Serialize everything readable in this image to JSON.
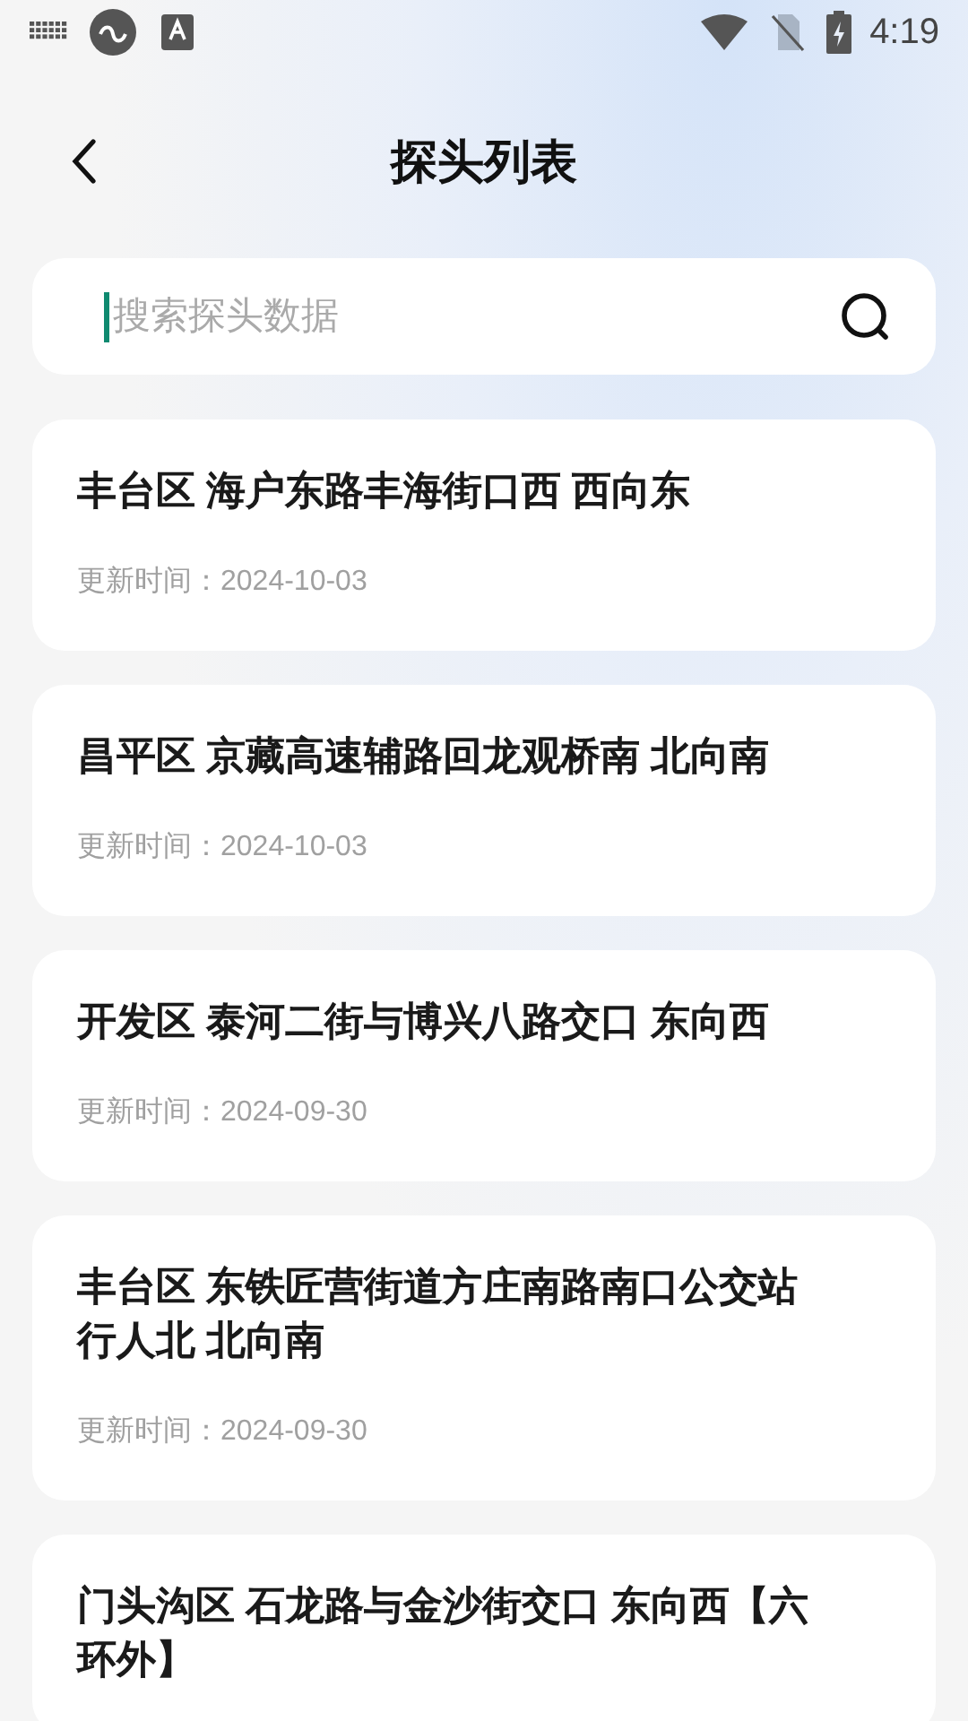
{
  "status_bar": {
    "time": "4:19"
  },
  "header": {
    "title": "探头列表"
  },
  "search": {
    "placeholder": "搜索探头数据",
    "focused": true
  },
  "probes": [
    {
      "name": "丰台区 海户东路丰海街口西 西向东",
      "updated": "更新时间：2024-10-03"
    },
    {
      "name": "昌平区 京藏高速辅路回龙观桥南 北向南",
      "updated": "更新时间：2024-10-03"
    },
    {
      "name": "开发区 泰河二街与博兴八路交口 东向西",
      "updated": "更新时间：2024-09-30"
    },
    {
      "name": "丰台区 东铁匠营街道方庄南路南口公交站行人北 北向南",
      "updated": "更新时间：2024-09-30"
    },
    {
      "name": "门头沟区 石龙路与金沙街交口 东向西【六环外】"
    }
  ]
}
